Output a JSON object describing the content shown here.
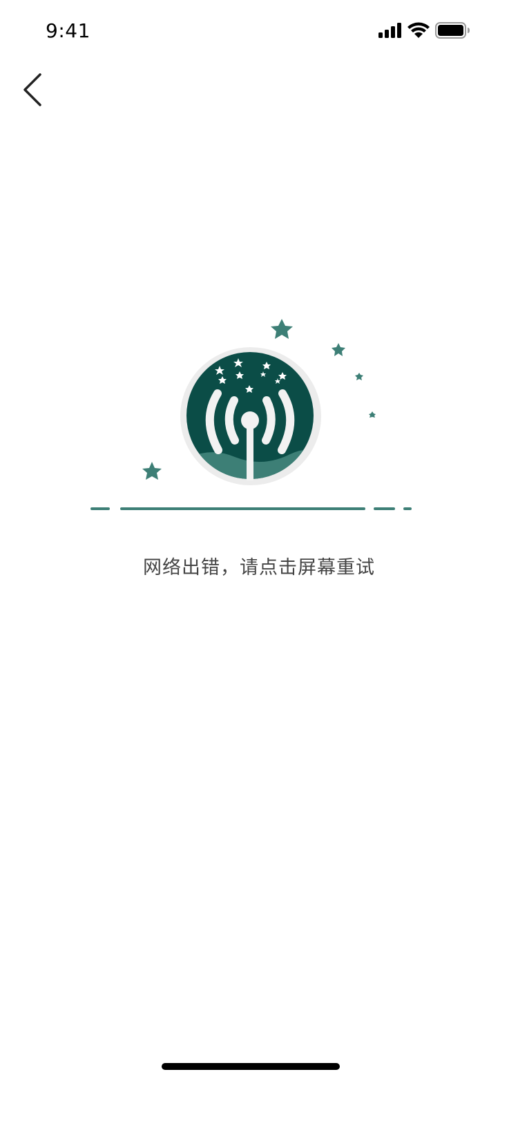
{
  "status_bar": {
    "time": "9:41"
  },
  "navigation": {
    "back_icon": "chevron-left-icon"
  },
  "illustration": {
    "icon": "broadcast-signal-icon",
    "accent_color": "#0b4d47",
    "star_color": "#3d7f76"
  },
  "error": {
    "message": "网络出错，请点击屏幕重试"
  },
  "colors": {
    "background": "#ffffff",
    "text": "#444444",
    "accent": "#0b4d47"
  }
}
